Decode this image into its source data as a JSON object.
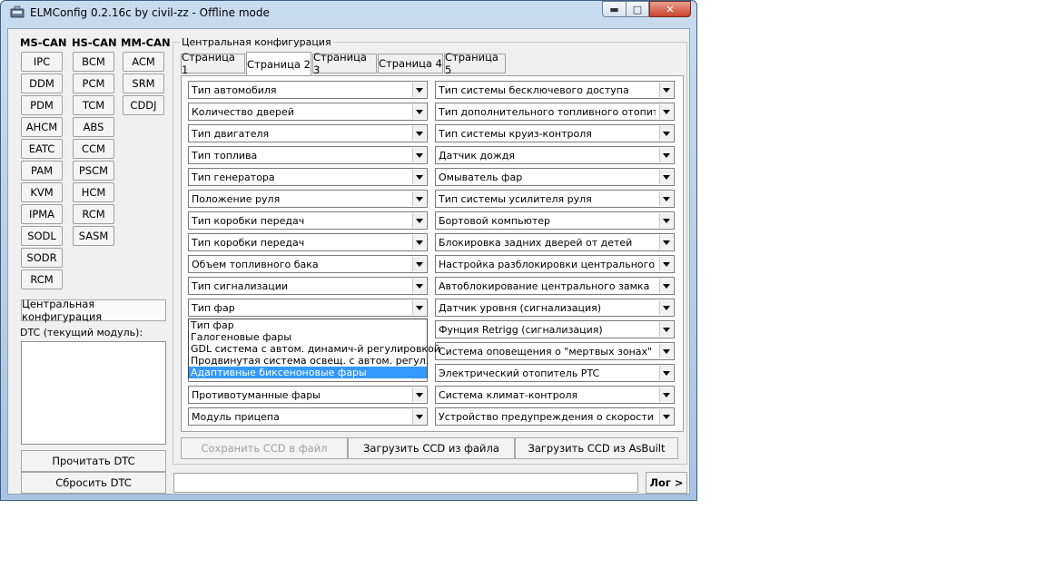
{
  "window": {
    "title": "ELMConfig 0.2.16c by civil-zz - Offline mode"
  },
  "columns": {
    "ms_can": {
      "header": "MS-CAN",
      "modules": [
        "IPC",
        "DDM",
        "PDM",
        "AHCM",
        "EATC",
        "PAM",
        "KVM",
        "IPMA",
        "SODL",
        "SODR",
        "RCM"
      ]
    },
    "hs_can": {
      "header": "HS-CAN",
      "modules": [
        "BCM",
        "PCM",
        "TCM",
        "ABS",
        "CCM",
        "PSCM",
        "HCM",
        "RCM",
        "SASM"
      ]
    },
    "mm_can": {
      "header": "MM-CAN",
      "modules": [
        "ACM",
        "SRM",
        "CDDJ"
      ]
    }
  },
  "left": {
    "central_config_button": "Центральная конфигурация",
    "dtc_label": "DTC (текущий модуль):",
    "read_dtc": "Прочитать DTC",
    "reset_dtc": "Сбросить DTC"
  },
  "central": {
    "group_label": "Центральная конфигурация",
    "tabs": [
      "Страница 1",
      "Страница 2",
      "Страница 3",
      "Страница 4",
      "Страница 5"
    ],
    "active_tab": "Страница 2",
    "left_combos": [
      "Тип автомобиля",
      "Количество дверей",
      "Тип двигателя",
      "Тип топлива",
      "Тип генератора",
      "Положение руля",
      "Тип коробки передач",
      "Тип коробки передач",
      "Объем топливного бака",
      "Тип сигнализации",
      "Тип фар",
      "",
      "",
      "",
      "Противотуманные фары",
      "Модуль прицепа"
    ],
    "right_combos": [
      "Тип системы бесключевого доступа",
      "Тип дополнительного топливного отопителя",
      "Тип системы круиз-контроля",
      "Датчик дождя",
      "Омыватель фар",
      "Тип системы усилителя руля",
      "Бортовой компьютер",
      "Блокировка задних дверей от детей",
      "Настройка разблокировки центрального замка",
      "Автоблокирование центрального замка",
      "Датчик уровня (сигнализация)",
      "Фунция Retrigg (сигнализация)",
      "Система оповещения о \"мертвых зонах\"",
      "Электрический отопитель PTC",
      "Система климат-контроля",
      "Устройство предупреждения о скорости"
    ],
    "dropdown_options": [
      "Тип фар",
      "Галогеновые фары",
      "GDL система  с автом. динамич-й регулировкой",
      "Продвинутая система освещ. с автом. регул.",
      "Адаптивные биксеноновые фары"
    ],
    "dropdown_selected_index": 4,
    "save_ccd": "Сохранить CCD в файл",
    "load_ccd_file": "Загрузить CCD из файла",
    "load_ccd_asbuilt": "Загрузить CCD из AsBuilt"
  },
  "log": {
    "input_value": "",
    "button": "Лог >"
  }
}
